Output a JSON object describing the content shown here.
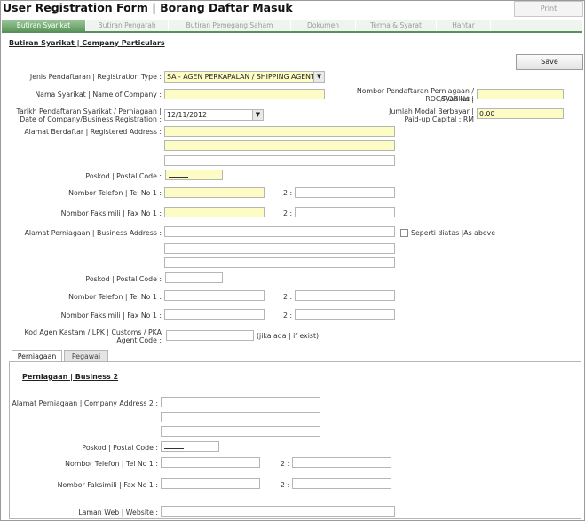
{
  "window": {
    "title": "User Registration Form | Borang Daftar Masuk",
    "print_label": "Print"
  },
  "tabs": [
    {
      "label": "Butiran Syarikat"
    },
    {
      "label": "Butiran Pengarah"
    },
    {
      "label": "Butiran Pemegang Saham"
    },
    {
      "label": "Dokumen"
    },
    {
      "label": "Terma & Syarat"
    },
    {
      "label": "Hantar"
    }
  ],
  "section": {
    "title": "Butiran Syarikat | Company Particulars",
    "save_label": "Save"
  },
  "company": {
    "reg_type_label": "Jenis Pendaftaran | Registration Type :",
    "reg_type_value": "SA - AGEN PERKAPALAN / SHIPPING AGENT",
    "name_label": "Nama Syarikat | Name of Company :",
    "name_value": "",
    "roc_label_1": "Nombor Pendaftaran Perniagaan / Syarikat |",
    "roc_label_2": "ROC/ROB No :",
    "roc_value": "",
    "reg_date_label_1": "Tarikh Pendaftaran Syarikat / Perniagaan |",
    "reg_date_label_2": "Date of Company/Business Registration :",
    "reg_date_value": "12/11/2012",
    "capital_label_1": "Jumlah Modal Berbayar |",
    "capital_label_2": "Paid-up Capital : RM",
    "capital_value": "0.00",
    "reg_address_label": "Alamat Berdaftar | Registered Address :",
    "postal_label": "Poskod | Postal Code :",
    "tel1_label": "Nombor Telefon | Tel No 1 :",
    "tel2_label": "2 :",
    "fax1_label": "Nombor Faksimili | Fax No 1 :",
    "fax2_label": "2 :"
  },
  "business": {
    "address_label": "Alamat Perniagaan | Business Address :",
    "same_as_label": "Seperti diatas |As above",
    "postal_label": "Poskod | Postal Code :",
    "tel1_label": "Nombor Telefon | Tel No 1 :",
    "tel2_label": "2 :",
    "fax1_label": "Nombor Faksimili | Fax No 1 :",
    "fax2_label": "2 :",
    "agent_code_label_1": "Kod Agen Kastam / LPK | Customs / PKA",
    "agent_code_label_2": "Agent Code :",
    "agent_code_note": "(jika ada | if exist)"
  },
  "subtabs": [
    {
      "label": "Perniagaan"
    },
    {
      "label": "Pegawai"
    }
  ],
  "business2": {
    "title": "Perniagaan | Business 2",
    "address_label": "Alamat Perniagaan | Company Address 2 :",
    "postal_label": "Poskod | Postal Code :",
    "tel1_label": "Nombor Telefon | Tel No 1 :",
    "tel2_label": "2 :",
    "fax1_label": "Nombor Faksimili | Fax No 1 :",
    "fax2_label": "2 :",
    "website_label": "Laman Web | Website :"
  }
}
